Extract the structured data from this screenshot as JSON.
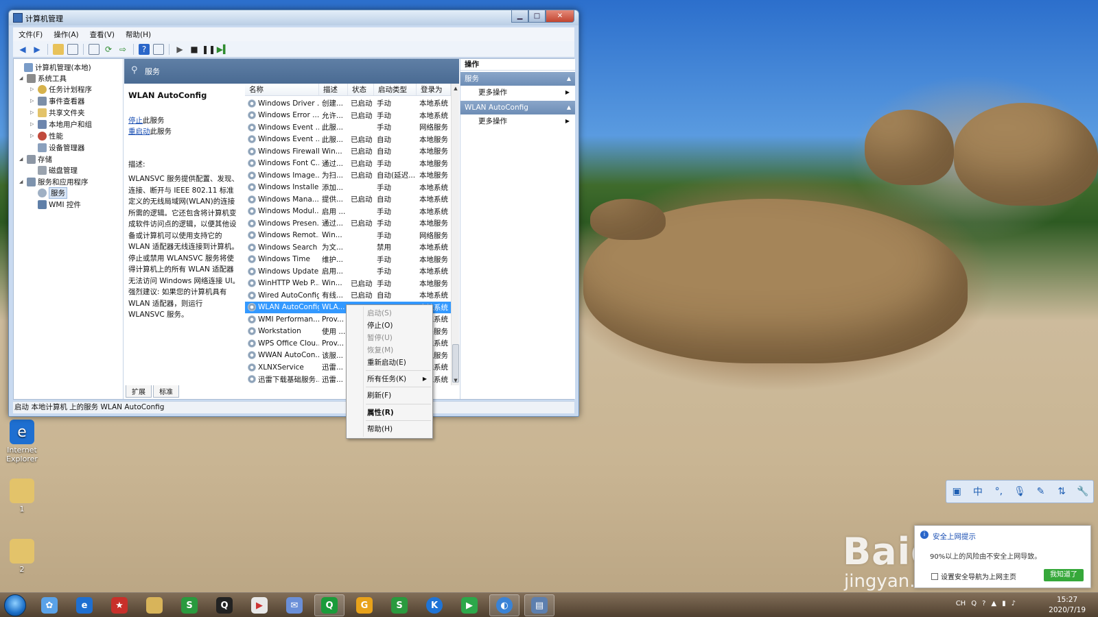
{
  "window": {
    "title": "计算机管理",
    "menu": [
      "文件(F)",
      "操作(A)",
      "查看(V)",
      "帮助(H)"
    ],
    "status": "启动 本地计算机 上的服务 WLAN AutoConfig"
  },
  "tree": [
    {
      "label": "计算机管理(本地)",
      "level": 0,
      "expand": ""
    },
    {
      "label": "系统工具",
      "level": 1,
      "expand": "◢"
    },
    {
      "label": "任务计划程序",
      "level": 2,
      "expand": "▷"
    },
    {
      "label": "事件查看器",
      "level": 2,
      "expand": "▷"
    },
    {
      "label": "共享文件夹",
      "level": 2,
      "expand": "▷"
    },
    {
      "label": "本地用户和组",
      "level": 2,
      "expand": "▷"
    },
    {
      "label": "性能",
      "level": 2,
      "expand": "▷"
    },
    {
      "label": "设备管理器",
      "level": 2,
      "expand": ""
    },
    {
      "label": "存储",
      "level": 1,
      "expand": "◢"
    },
    {
      "label": "磁盘管理",
      "level": 2,
      "expand": ""
    },
    {
      "label": "服务和应用程序",
      "level": 1,
      "expand": "◢"
    },
    {
      "label": "服务",
      "level": 2,
      "expand": "",
      "selected": true
    },
    {
      "label": "WMI 控件",
      "level": 2,
      "expand": ""
    }
  ],
  "center": {
    "header": "服务",
    "service_name": "WLAN AutoConfig",
    "stop_link": "停止",
    "stop_rest": "此服务",
    "restart_link": "重启动",
    "restart_rest": "此服务",
    "desc_label": "描述:",
    "desc_text": "WLANSVC 服务提供配置、发现、连接、断开与 IEEE 802.11 标准定义的无线局域网(WLAN)的连接所需的逻辑。它还包含将计算机变成软件访问点的逻辑，以便其他设备或计算机可以使用支持它的 WLAN 适配器无线连接到计算机。停止或禁用 WLANSVC 服务将使得计算机上的所有 WLAN 适配器无法访问 Windows 网络连接 UI。强烈建议: 如果您的计算机具有 WLAN 适配器，则运行 WLANSVC 服务。"
  },
  "list": {
    "columns": [
      "名称",
      "描述",
      "状态",
      "启动类型",
      "登录为"
    ],
    "rows": [
      [
        "Windows Driver ...",
        "创建...",
        "已启动",
        "手动",
        "本地系统"
      ],
      [
        "Windows Error ...",
        "允许...",
        "已启动",
        "手动",
        "本地系统"
      ],
      [
        "Windows Event ...",
        "此服...",
        "",
        "手动",
        "网络服务"
      ],
      [
        "Windows Event ...",
        "此服...",
        "已启动",
        "自动",
        "本地服务"
      ],
      [
        "Windows Firewall",
        "Win...",
        "已启动",
        "自动",
        "本地服务"
      ],
      [
        "Windows Font C...",
        "通过...",
        "已启动",
        "手动",
        "本地服务"
      ],
      [
        "Windows Image...",
        "为扫...",
        "已启动",
        "自动(延迟...",
        "本地服务"
      ],
      [
        "Windows Installer",
        "添加...",
        "",
        "手动",
        "本地系统"
      ],
      [
        "Windows Mana...",
        "提供...",
        "已启动",
        "自动",
        "本地系统"
      ],
      [
        "Windows Modul...",
        "启用 ...",
        "",
        "手动",
        "本地系统"
      ],
      [
        "Windows Presen...",
        "通过...",
        "已启动",
        "手动",
        "本地服务"
      ],
      [
        "Windows Remot...",
        "Win...",
        "",
        "手动",
        "网络服务"
      ],
      [
        "Windows Search",
        "为文...",
        "",
        "禁用",
        "本地系统"
      ],
      [
        "Windows Time",
        "维护...",
        "",
        "手动",
        "本地服务"
      ],
      [
        "Windows Update",
        "启用...",
        "",
        "手动",
        "本地系统"
      ],
      [
        "WinHTTP Web P...",
        "Win...",
        "已启动",
        "手动",
        "本地服务"
      ],
      [
        "Wired AutoConfig",
        "有线...",
        "已启动",
        "自动",
        "本地系统"
      ],
      [
        "WLAN AutoConfig",
        "WLA...",
        "",
        "",
        "本地系统"
      ],
      [
        "WMI Performan...",
        "Prov...",
        "",
        "",
        "本地系统"
      ],
      [
        "Workstation",
        "使用 ...",
        "",
        "",
        "网络服务"
      ],
      [
        "WPS Office Clou...",
        "Prov...",
        "",
        "",
        "本地系统"
      ],
      [
        "WWAN AutoCon...",
        "该服...",
        "",
        "",
        "本地服务"
      ],
      [
        "XLNXService",
        "迅雷...",
        "",
        "",
        "本地系统"
      ],
      [
        "迅雷下载基础服务...",
        "迅雷...",
        "",
        "",
        "本地系统"
      ]
    ],
    "selected_index": 17
  },
  "tabs": [
    "扩展",
    "标准"
  ],
  "actions_pane": {
    "title": "操作",
    "section1": "服务",
    "section1_item": "更多操作",
    "section2": "WLAN AutoConfig",
    "section2_item": "更多操作"
  },
  "context_menu": [
    {
      "label": "启动(S)",
      "disabled": true
    },
    {
      "label": "停止(O)",
      "disabled": false
    },
    {
      "label": "暂停(U)",
      "disabled": true
    },
    {
      "label": "恢复(M)",
      "disabled": true
    },
    {
      "label": "重新启动(E)",
      "disabled": false
    },
    {
      "label": "所有任务(K)",
      "disabled": false,
      "submenu": true
    },
    {
      "label": "刷新(F)",
      "disabled": false
    },
    {
      "label": "属性(R)",
      "disabled": false,
      "bold": true
    },
    {
      "label": "帮助(H)",
      "disabled": false
    }
  ],
  "desktop_icons": [
    {
      "label": "Internet Explorer",
      "icon": "ie-icon"
    },
    {
      "label": "1",
      "icon": "folder-icon"
    },
    {
      "label": "2",
      "icon": "folder-icon"
    }
  ],
  "ime": {
    "lang": "中",
    "icons": [
      "toolbox-icon",
      "lang-icon",
      "punct-icon",
      "mic-icon",
      "pen-icon",
      "swap-icon",
      "wrench-icon"
    ]
  },
  "notification": {
    "title": "安全上网提示",
    "text": "90%以上的风险由不安全上网导致。",
    "checkbox": "设置安全导航为上网主页",
    "button": "我知道了"
  },
  "watermark": {
    "main": "Baidu经验",
    "sub": "jingyan.baidu.com"
  },
  "taskbar": {
    "apps": [
      "photos-icon",
      "ie-icon",
      "app-icon",
      "explorer-icon",
      "sheets-icon",
      "qq-icon",
      "youku-icon",
      "mail-icon",
      "iqiyi-icon",
      "g-icon",
      "sheets2-icon",
      "kugou-icon",
      "player-icon",
      "browser-icon",
      "computer-mgmt-icon"
    ],
    "tray_lang": "CH",
    "time": "15:27",
    "date": "2020/7/19"
  }
}
